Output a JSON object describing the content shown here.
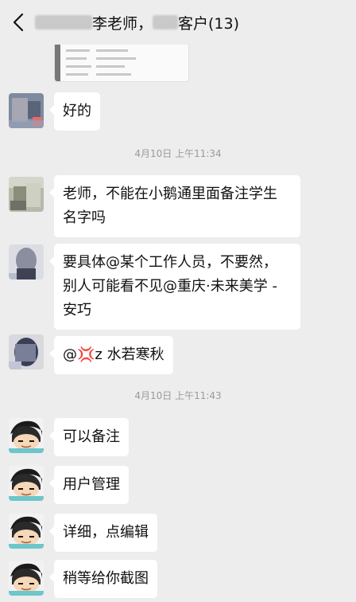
{
  "header": {
    "title_name": "李老师，",
    "title_suffix": "客户(13)"
  },
  "timestamps": {
    "t1": "4月10日 上午11:34",
    "t2": "4月10日 上午11:43"
  },
  "messages": {
    "m1": "好的",
    "m2_line1": "老师，不能在小鹅通里面备注学生",
    "m2_line2": "名字吗",
    "m3_line1": "要具体@某个工作人员，不要然，",
    "m3_line2": "别人可能看不见@重庆·未来美学 -",
    "m3_line3": "安巧",
    "m4": "@💢z 水若寒秋",
    "m5": "可以备注",
    "m6": "用户管理",
    "m7": "详细，点编辑",
    "m8": "稍等给你截图"
  },
  "icons": {
    "back": "chevron-left-icon",
    "anger_emoji": "anger-symbol-icon"
  },
  "colors": {
    "background": "#ededed",
    "bubble": "#ffffff",
    "timestamp": "#9a9a9a"
  }
}
